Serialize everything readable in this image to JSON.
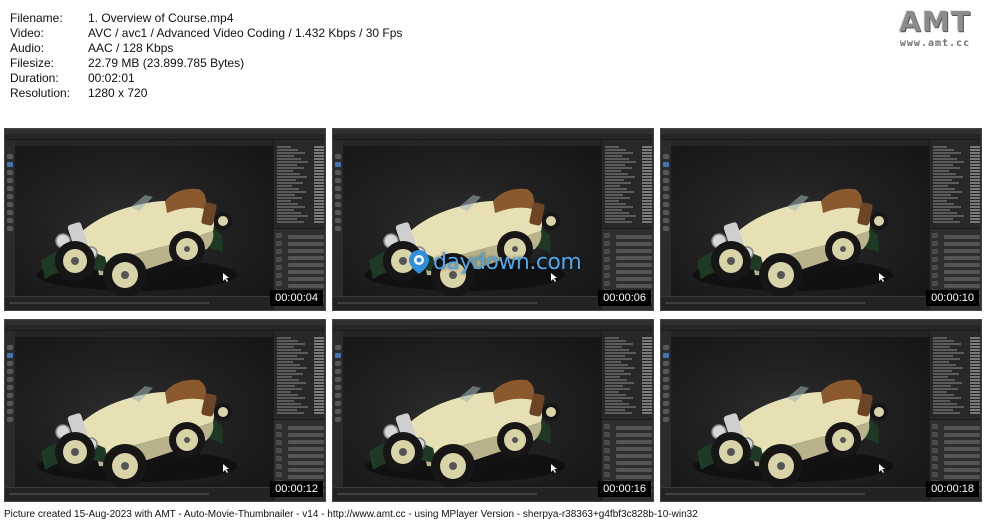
{
  "info": [
    {
      "label": "Filename:",
      "value": "1. Overview of Course.mp4"
    },
    {
      "label": "Video:",
      "value": "AVC / avc1 / Advanced Video Coding / 1.432 Kbps / 30 Fps"
    },
    {
      "label": "Audio:",
      "value": "AAC / 128 Kbps"
    },
    {
      "label": "Filesize:",
      "value": "22.79 MB (23.899.785 Bytes)"
    },
    {
      "label": "Duration:",
      "value": "00:02:01"
    },
    {
      "label": "Resolution:",
      "value": "1280 x 720"
    }
  ],
  "logo": {
    "text": "AMT",
    "url": "www.amt.cc"
  },
  "thumbnails": [
    {
      "timestamp": "00:00:04"
    },
    {
      "timestamp": "00:00:06"
    },
    {
      "timestamp": "00:00:10"
    },
    {
      "timestamp": "00:00:12"
    },
    {
      "timestamp": "00:00:16"
    },
    {
      "timestamp": "00:00:18"
    }
  ],
  "watermark": {
    "text": "daydown.com",
    "color": "#4ea7e8"
  },
  "footer": "Picture created 15-Aug-2023 with AMT - Auto-Movie-Thumbnailer - v14 - http://www.amt.cc - using MPlayer Version - sherpya-r38363+g4fbf3c828b-10-win32",
  "colors": {
    "accent": "#4772b3",
    "car_body": "#e6e0b4",
    "car_fender": "#1f3a24",
    "car_seat": "#8a5a2e"
  }
}
